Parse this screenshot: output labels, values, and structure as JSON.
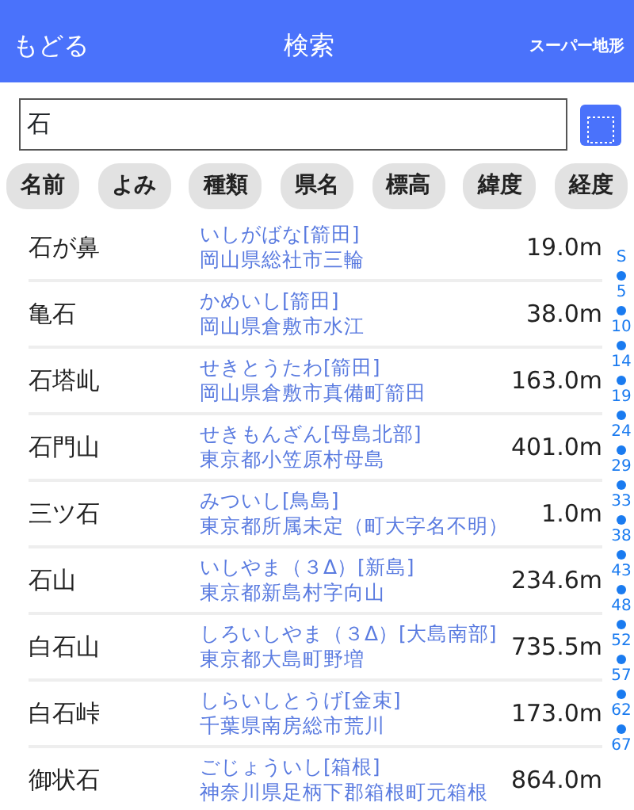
{
  "header": {
    "back": "もどる",
    "title": "検索",
    "right": "スーパー地形"
  },
  "search": {
    "value": "石"
  },
  "sort_buttons": [
    "名前",
    "よみ",
    "種類",
    "県名",
    "標高",
    "緯度",
    "経度"
  ],
  "rows": [
    {
      "name": "石が鼻",
      "reading": "いしがばな[箭田]",
      "address": "岡山県総社市三輪",
      "elevation": "19.0m"
    },
    {
      "name": "亀石",
      "reading": "かめいし[箭田]",
      "address": "岡山県倉敷市水江",
      "elevation": "38.0m"
    },
    {
      "name": "石塔乢",
      "reading": "せきとうたわ[箭田]",
      "address": "岡山県倉敷市真備町箭田",
      "elevation": "163.0m"
    },
    {
      "name": "石門山",
      "reading": "せきもんざん[母島北部]",
      "address": "東京都小笠原村母島",
      "elevation": "401.0m"
    },
    {
      "name": "三ツ石",
      "reading": "みついし[鳥島]",
      "address": "東京都所属未定（町大字名不明）",
      "elevation": "1.0m"
    },
    {
      "name": "石山",
      "reading": "いしやま（３Δ）[新島]",
      "address": "東京都新島村字向山",
      "elevation": "234.6m"
    },
    {
      "name": "白石山",
      "reading": "しろいしやま（３Δ）[大島南部]",
      "address": "東京都大島町野増",
      "elevation": "735.5m"
    },
    {
      "name": "白石峠",
      "reading": "しらいしとうげ[金束]",
      "address": "千葉県南房総市荒川",
      "elevation": "173.0m"
    },
    {
      "name": "御状石",
      "reading": "ごじょういし[箱根]",
      "address": "神奈川県足柄下郡箱根町元箱根",
      "elevation": "864.0m"
    }
  ],
  "index": [
    "S",
    "5",
    "10",
    "14",
    "19",
    "24",
    "29",
    "33",
    "38",
    "43",
    "48",
    "52",
    "57",
    "62",
    "67"
  ]
}
